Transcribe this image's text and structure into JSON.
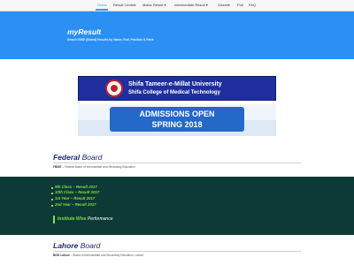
{
  "nav": {
    "items": [
      {
        "label": "Home",
        "active": true
      },
      {
        "label": "Result Central",
        "active": false
      },
      {
        "label": "Matric Result ▾",
        "active": false
      },
      {
        "label": "Intermediate Result ▾",
        "active": false
      },
      {
        "label": "Gazette",
        "active": false
      },
      {
        "label": "Poll",
        "active": false
      },
      {
        "label": "FAQ",
        "active": false
      }
    ]
  },
  "hero": {
    "title": "myResult",
    "tagline": "Search BISE (Board) Results by Name, Roll, Position & Rank"
  },
  "banner1": {
    "line1": "Shifa Tameer-e-Millat University",
    "line2": "Shifa College of Medical Technology"
  },
  "banner2": {
    "line1": "ADMISSIONS OPEN",
    "line2": "SPRING 2018"
  },
  "federal": {
    "title_bold": "Federal",
    "title_rest": "Board",
    "abbr": "FBISE",
    "desc": "– Federal Board of Intermediate and Secondary Education"
  },
  "results": {
    "links": [
      "9th Class – Result 2017",
      "10th Class – Result 2017",
      "1st Year – Result 2017",
      "2nd Year – Result 2017"
    ],
    "performance_bold": "Institute Wise",
    "performance_rest": "Performance"
  },
  "lahore": {
    "title_bold": "Lahore",
    "title_rest": "Board",
    "abbr": "BISE Lahore",
    "desc": "– Board of Intermediate and Secondary Education, Lahore"
  },
  "colors": {
    "accent": "#2b8ff3",
    "dark_section": "#0d3a36",
    "link_green": "#7fe04a",
    "board_title": "#1d2b7a"
  }
}
